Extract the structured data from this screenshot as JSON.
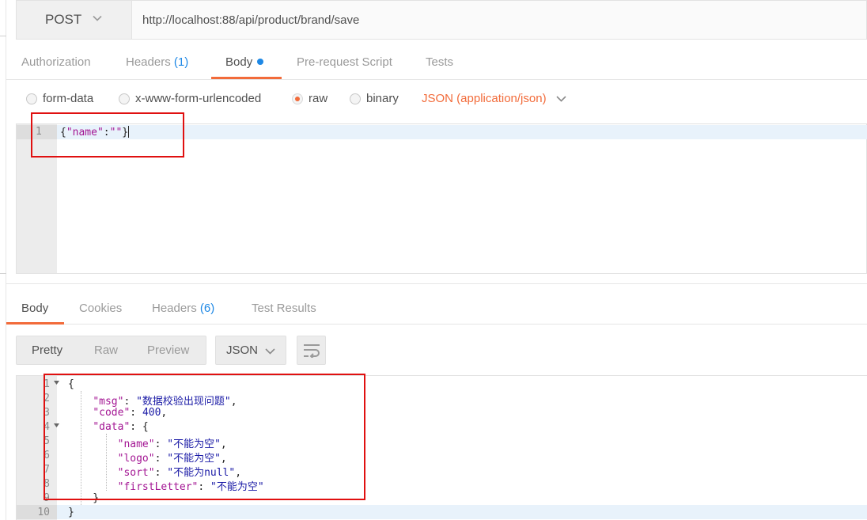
{
  "request": {
    "method": "POST",
    "url": "http://localhost:88/api/product/brand/save",
    "tabs": {
      "authorization": "Authorization",
      "headers": "Headers",
      "headers_count": "(1)",
      "body": "Body",
      "pre_request": "Pre-request Script",
      "tests": "Tests"
    },
    "body_types": {
      "form_data": "form-data",
      "urlencoded": "x-www-form-urlencoded",
      "raw": "raw",
      "binary": "binary",
      "selected": "raw",
      "content_type": "JSON (application/json)"
    },
    "editor": {
      "line_number": "1",
      "code": "{\"name\":\"\"}"
    }
  },
  "response": {
    "tabs": {
      "body": "Body",
      "cookies": "Cookies",
      "headers": "Headers",
      "headers_count": "(6)",
      "test_results": "Test Results"
    },
    "view_modes": {
      "pretty": "Pretty",
      "raw": "Raw",
      "preview": "Preview"
    },
    "format": "JSON",
    "lines": [
      {
        "num": "1",
        "text": "{"
      },
      {
        "num": "2",
        "text": "    \"msg\": \"数据校验出现问题\","
      },
      {
        "num": "3",
        "text": "    \"code\": 400,"
      },
      {
        "num": "4",
        "text": "    \"data\": {"
      },
      {
        "num": "5",
        "text": "        \"name\": \"不能为空\","
      },
      {
        "num": "6",
        "text": "        \"logo\": \"不能为空\","
      },
      {
        "num": "7",
        "text": "        \"sort\": \"不能为null\","
      },
      {
        "num": "8",
        "text": "        \"firstLetter\": \"不能为空\""
      },
      {
        "num": "9",
        "text": "    }"
      },
      {
        "num": "10",
        "text": "}"
      }
    ]
  },
  "colors": {
    "accent": "#f26b3a",
    "link_blue": "#1e88e5",
    "highlight_box": "#e01010"
  },
  "icons": [
    "chevron-down-icon",
    "wrap-lines-icon",
    "fold-arrow-icon"
  ]
}
